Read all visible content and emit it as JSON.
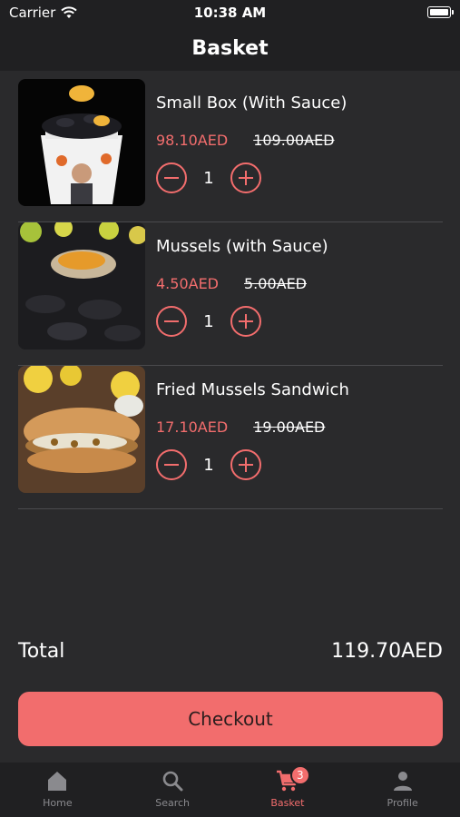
{
  "status_bar": {
    "carrier": "Carrier",
    "time": "10:38 AM"
  },
  "header": {
    "title": "Basket"
  },
  "items": [
    {
      "name": "Small Box (With Sauce)",
      "price": "98.10AED",
      "original_price": "109.00AED",
      "quantity": "1"
    },
    {
      "name": "Mussels (with Sauce)",
      "price": "4.50AED",
      "original_price": "5.00AED",
      "quantity": "1"
    },
    {
      "name": "Fried Mussels Sandwich",
      "price": "17.10AED",
      "original_price": "19.00AED",
      "quantity": "1"
    }
  ],
  "summary": {
    "total_label": "Total",
    "total_value": "119.70AED"
  },
  "checkout": {
    "label": "Checkout"
  },
  "tabs": [
    {
      "label": "Home",
      "icon": "home-icon"
    },
    {
      "label": "Search",
      "icon": "search-icon"
    },
    {
      "label": "Basket",
      "icon": "cart-icon",
      "badge": "3",
      "active": true
    },
    {
      "label": "Profile",
      "icon": "person-icon"
    }
  ],
  "colors": {
    "accent": "#f26d6d",
    "background": "#2a2a2c",
    "bar": "#202022",
    "inactive": "#8a8a8e"
  }
}
